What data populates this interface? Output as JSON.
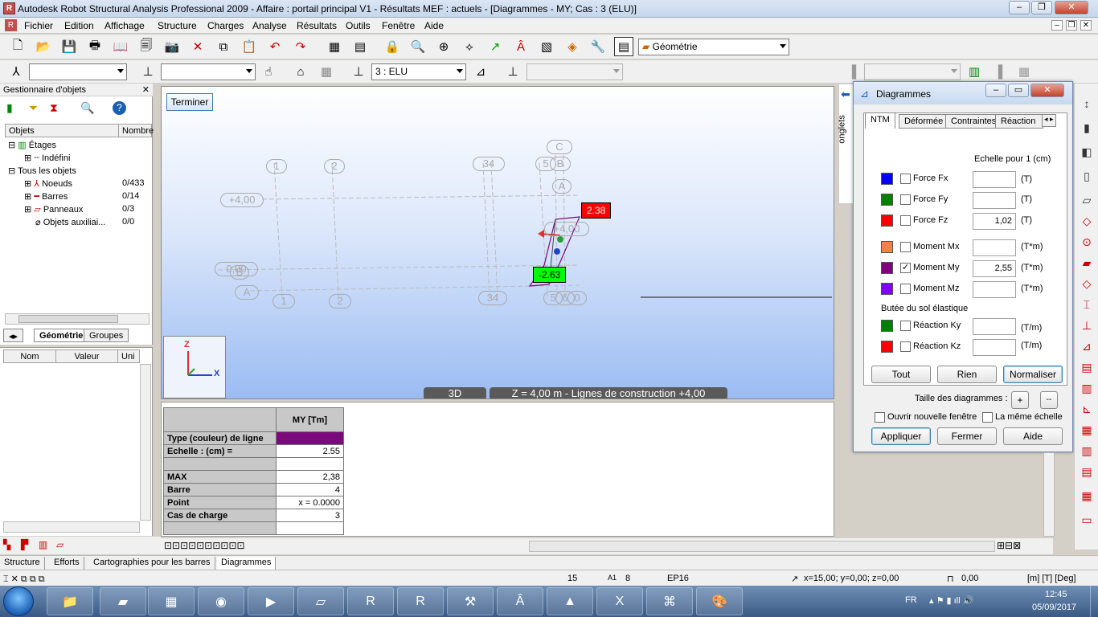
{
  "window": {
    "title": "Autodesk Robot Structural Analysis Professional 2009 - Affaire : portail principal V1 - Résultats MEF : actuels - [Diagrammes - MY; Cas : 3 (ELU)]",
    "app_icon_letter": "R"
  },
  "menu": [
    "Fichier",
    "Edition",
    "Affichage",
    "Structure",
    "Charges",
    "Analyse",
    "Résultats",
    "Outils",
    "Fenêtre",
    "Aide"
  ],
  "toolbar": {
    "layout_select": "Géométrie",
    "case_select": "3 : ELU"
  },
  "object_manager": {
    "title": "Gestionnaire d'objets",
    "col_objects": "Objets",
    "col_number": "Nombre",
    "tree": [
      {
        "label": "Étages",
        "count": ""
      },
      {
        "label": "Indéfini",
        "count": ""
      },
      {
        "label": "Tous les objets",
        "count": ""
      },
      {
        "label": "Noeuds",
        "count": "0/433"
      },
      {
        "label": "Barres",
        "count": "0/14"
      },
      {
        "label": "Panneaux",
        "count": "0/3"
      },
      {
        "label": "Objets auxiliai...",
        "count": "0/0"
      }
    ],
    "tabs": [
      "Géométrie",
      "Groupes"
    ]
  },
  "properties": {
    "col_name": "Nom",
    "col_value": "Valeur",
    "col_unit": "Uni"
  },
  "viewport": {
    "finish_button": "Terminer",
    "view_mode": "3D",
    "view_caption": "Z = 4,00 m - Lignes de construction +4,00",
    "label_max": "2.38",
    "label_min": "-2.63",
    "axis_z": "Z",
    "axis_x": "X",
    "grid_labels": [
      "1",
      "2",
      "34",
      "5",
      "B",
      "C",
      "A",
      "+4,00",
      "+4,00",
      "0,00",
      "B",
      "A",
      "1",
      "2",
      "34",
      "5",
      "6",
      "0"
    ]
  },
  "result_table": {
    "header": "MY [Tm]",
    "rows": [
      {
        "label": "Type (couleur) de ligne",
        "value": ""
      },
      {
        "label": "Echelle : (cm) =",
        "value": "2.55"
      },
      {
        "label": "",
        "value": ""
      },
      {
        "label": "MAX",
        "value": "2,38"
      },
      {
        "label": "Barre",
        "value": "4"
      },
      {
        "label": "Point",
        "value": "x = 0.0000"
      },
      {
        "label": "Cas de charge",
        "value": "3"
      },
      {
        "label": "",
        "value": ""
      }
    ],
    "line_color": "#7a0a7a"
  },
  "dialog": {
    "title": "Diagrammes",
    "side_tab": "onglets",
    "tabs": [
      "NTM",
      "Déformée",
      "Contraintes",
      "Réaction"
    ],
    "scale_header": "Echelle pour 1  (cm)",
    "items": [
      {
        "label": "Force Fx",
        "checked": false,
        "value": "",
        "unit": "(T)",
        "color": "#0000ff"
      },
      {
        "label": "Force Fy",
        "checked": false,
        "value": "",
        "unit": "(T)",
        "color": "#008000"
      },
      {
        "label": "Force Fz",
        "checked": false,
        "value": "1,02",
        "unit": "(T)",
        "color": "#ff0000"
      },
      {
        "label": "Moment Mx",
        "checked": false,
        "value": "",
        "unit": "(T*m)",
        "color": "#ff8040"
      },
      {
        "label": "Moment My",
        "checked": true,
        "value": "2,55",
        "unit": "(T*m)",
        "color": "#800080"
      },
      {
        "label": "Moment Mz",
        "checked": false,
        "value": "",
        "unit": "(T*m)",
        "color": "#8000ff"
      }
    ],
    "soil_header": "Butée du sol élastique",
    "soil_items": [
      {
        "label": "Réaction Ky",
        "checked": false,
        "value": "",
        "unit": "(T/m)",
        "color": "#008000"
      },
      {
        "label": "Réaction Kz",
        "checked": false,
        "value": "",
        "unit": "(T/m)",
        "color": "#ff0000"
      }
    ],
    "btn_all": "Tout",
    "btn_none": "Rien",
    "btn_normalize": "Normaliser",
    "size_label": "Taille des diagrammes :",
    "btn_plus": "+",
    "btn_minus": "--",
    "cb_new_window": "Ouvrir nouvelle fenêtre",
    "cb_same_scale": "La même échelle",
    "btn_apply": "Appliquer",
    "btn_close": "Fermer",
    "btn_help": "Aide"
  },
  "bottom_tabs": [
    "Structure",
    "Efforts",
    "Cartographies pour les barres",
    "Diagrammes"
  ],
  "status": {
    "num1": "15",
    "num2": "8",
    "section": "EP16",
    "coords": "x=15,00; y=0,00; z=0,00",
    "angle": "0,00",
    "units": "[m] [T] [Deg]"
  },
  "taskbar": {
    "lang": "FR",
    "time": "12:45",
    "date": "05/09/2017"
  }
}
